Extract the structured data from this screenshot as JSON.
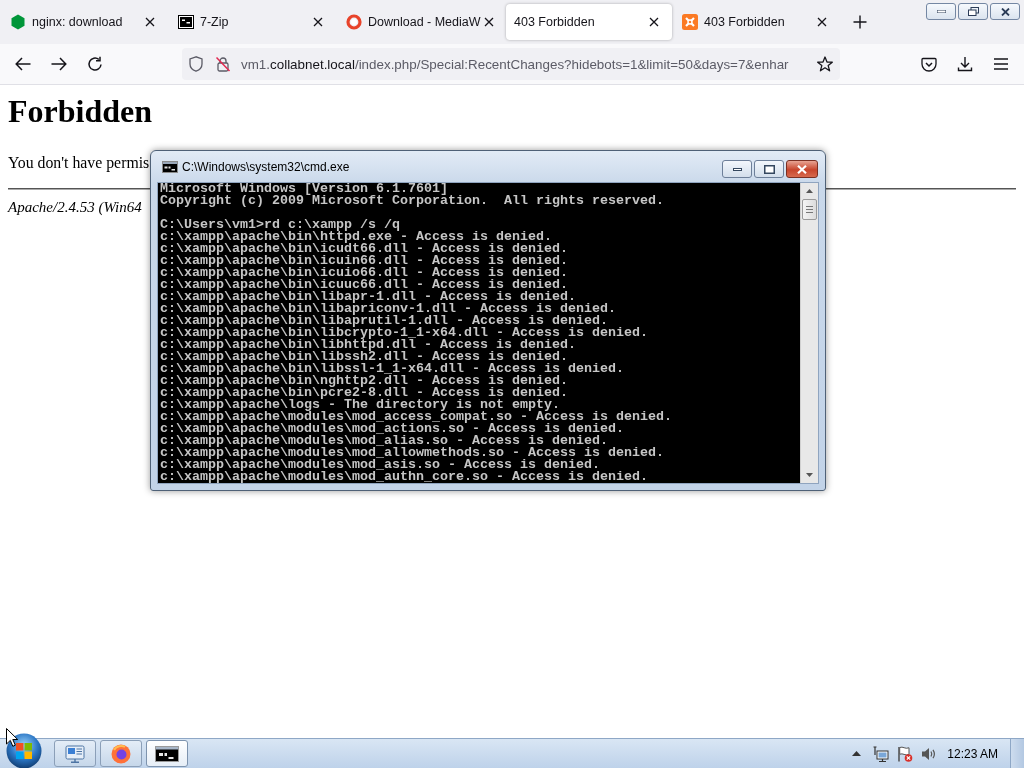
{
  "browser": {
    "tabs": [
      {
        "label": "nginx: download",
        "selected": false
      },
      {
        "label": "7-Zip",
        "selected": false
      },
      {
        "label": "Download - MediaW",
        "selected": false
      },
      {
        "label": "403 Forbidden",
        "selected": true
      },
      {
        "label": "403 Forbidden",
        "selected": false
      }
    ],
    "address_bar": {
      "subdomain": "vm1.",
      "domain": "collabnet.local",
      "path": "/index.php/Special:RecentChanges?hidebots=1&limit=50&days=7&enhar"
    }
  },
  "page": {
    "heading": "Forbidden",
    "message": "You don't have permis",
    "footer": "Apache/2.4.53 (Win64"
  },
  "console_window": {
    "title": "C:\\Windows\\system32\\cmd.exe",
    "output": [
      [
        "Microsoft Windows [Version 6.1.7601]",
        "Copyright (c) 2009 Microsoft Corporation.  All rights reserved."
      ],
      [
        "C:\\Users\\vm1>rd c:\\xampp /s /q",
        "c:\\xampp\\apache\\bin\\httpd.exe - Access is denied.",
        "c:\\xampp\\apache\\bin\\icudt66.dll - Access is denied.",
        "c:\\xampp\\apache\\bin\\icuin66.dll - Access is denied.",
        "c:\\xampp\\apache\\bin\\icuio66.dll - Access is denied.",
        "c:\\xampp\\apache\\bin\\icuuc66.dll - Access is denied.",
        "c:\\xampp\\apache\\bin\\libapr-1.dll - Access is denied.",
        "c:\\xampp\\apache\\bin\\libapriconv-1.dll - Access is denied.",
        "c:\\xampp\\apache\\bin\\libaprutil-1.dll - Access is denied.",
        "c:\\xampp\\apache\\bin\\libcrypto-1_1-x64.dll - Access is denied.",
        "c:\\xampp\\apache\\bin\\libhttpd.dll - Access is denied.",
        "c:\\xampp\\apache\\bin\\libssh2.dll - Access is denied.",
        "c:\\xampp\\apache\\bin\\libssl-1_1-x64.dll - Access is denied.",
        "c:\\xampp\\apache\\bin\\nghttp2.dll - Access is denied.",
        "c:\\xampp\\apache\\bin\\pcre2-8.dll - Access is denied.",
        "c:\\xampp\\apache\\logs - The directory is not empty.",
        "c:\\xampp\\apache\\modules\\mod_access_compat.so - Access is denied.",
        "c:\\xampp\\apache\\modules\\mod_actions.so - Access is denied.",
        "c:\\xampp\\apache\\modules\\mod_alias.so - Access is denied.",
        "c:\\xampp\\apache\\modules\\mod_allowmethods.so - Access is denied.",
        "c:\\xampp\\apache\\modules\\mod_asis.so - Access is denied.",
        "c:\\xampp\\apache\\modules\\mod_authn_core.so - Access is denied."
      ]
    ]
  },
  "taskbar": {
    "buttons": [
      {
        "selected": false
      },
      {
        "selected": false
      },
      {
        "selected": true
      }
    ],
    "clock": "12:23 AM"
  }
}
